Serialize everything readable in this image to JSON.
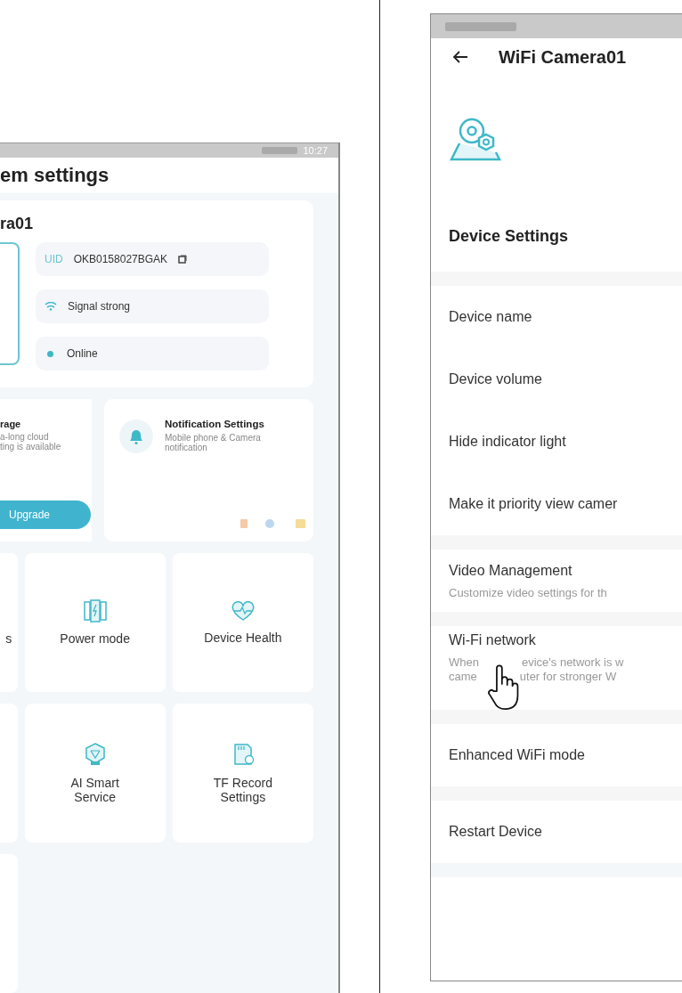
{
  "left_screen": {
    "status_bar": {
      "time": "10:27"
    },
    "title": "em settings",
    "device": {
      "name": "ra01",
      "uid_label": "UID",
      "uid": "OKB0158027BGAK",
      "signal": "Signal strong",
      "status": "Online"
    },
    "cloud_card": {
      "title": "rage",
      "lines": [
        "a-long cloud",
        "ting is available"
      ],
      "button": "Upgrade"
    },
    "notification_card": {
      "title": "Notification Settings",
      "subtitle": "Mobile phone & Camera notification"
    },
    "tile_rows": [
      {
        "tiles": [
          {
            "kind": "text",
            "label": "s"
          },
          {
            "kind": "power",
            "label": "Power mode"
          },
          {
            "kind": "health",
            "label": "Device Health"
          }
        ]
      },
      {
        "tiles": [
          {
            "kind": "blank"
          },
          {
            "kind": "ai",
            "label": "AI Smart Service"
          },
          {
            "kind": "tf",
            "label": "TF Record Settings"
          }
        ]
      },
      {
        "tiles": [
          {
            "kind": "blank"
          }
        ]
      }
    ]
  },
  "right_screen": {
    "title": "WiFi Camera01",
    "section": "Device Settings",
    "groups": [
      {
        "rows": [
          {
            "label": "Device name"
          },
          {
            "label": "Device volume"
          },
          {
            "label": "Hide indicator light"
          },
          {
            "label": "Make it priority view camer"
          }
        ]
      },
      {
        "rows": [
          {
            "label": "Video Management",
            "description": [
              [
                "Customize video settings for th"
              ]
            ]
          }
        ]
      },
      {
        "rows": [
          {
            "label": "Wi-Fi network",
            "description": [
              [
                "When",
                "evice's network is w"
              ],
              [
                "came",
                "uter for stronger W"
              ]
            ],
            "pointer": true
          }
        ]
      },
      {
        "rows": [
          {
            "label": "Enhanced WiFi mode"
          }
        ]
      },
      {
        "rows": [
          {
            "label": "Restart Device"
          }
        ]
      }
    ]
  }
}
